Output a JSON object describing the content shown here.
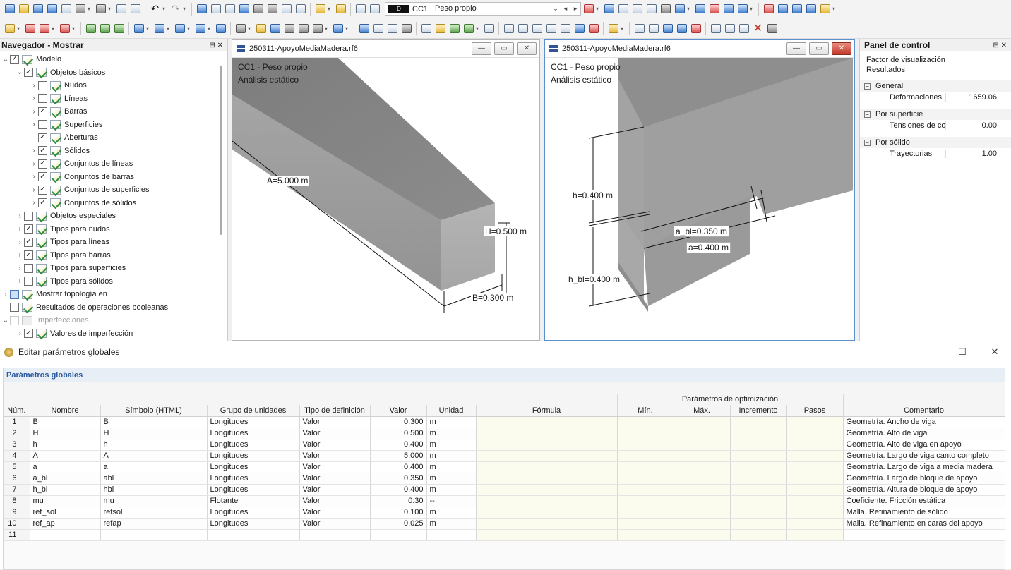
{
  "toolbar": {
    "loadcase_id": "CC1",
    "loadcase_name": "Peso propio",
    "loadcase_tag": "D"
  },
  "navigator": {
    "title": "Navegador - Mostrar",
    "pin": "⊟  ✕",
    "items": [
      {
        "label": "Modelo",
        "level": 0,
        "expander": "⌄",
        "state": "checked"
      },
      {
        "label": "Objetos básicos",
        "level": 1,
        "expander": "⌄",
        "state": "checked"
      },
      {
        "label": "Nudos",
        "level": 2,
        "expander": "›",
        "state": "unchecked"
      },
      {
        "label": "Líneas",
        "level": 2,
        "expander": "›",
        "state": "unchecked"
      },
      {
        "label": "Barras",
        "level": 2,
        "expander": "›",
        "state": "checked"
      },
      {
        "label": "Superficies",
        "level": 2,
        "expander": "›",
        "state": "unchecked"
      },
      {
        "label": "Aberturas",
        "level": 2,
        "expander": "",
        "state": "checked"
      },
      {
        "label": "Sólidos",
        "level": 2,
        "expander": "›",
        "state": "checked"
      },
      {
        "label": "Conjuntos de líneas",
        "level": 2,
        "expander": "›",
        "state": "checked"
      },
      {
        "label": "Conjuntos de barras",
        "level": 2,
        "expander": "›",
        "state": "checked"
      },
      {
        "label": "Conjuntos de superficies",
        "level": 2,
        "expander": "›",
        "state": "checked"
      },
      {
        "label": "Conjuntos de sólidos",
        "level": 2,
        "expander": "›",
        "state": "checked"
      },
      {
        "label": "Objetos especiales",
        "level": 1,
        "expander": "›",
        "state": "unchecked"
      },
      {
        "label": "Tipos para nudos",
        "level": 1,
        "expander": "›",
        "state": "checked"
      },
      {
        "label": "Tipos para líneas",
        "level": 1,
        "expander": "›",
        "state": "checked"
      },
      {
        "label": "Tipos para barras",
        "level": 1,
        "expander": "›",
        "state": "checked"
      },
      {
        "label": "Tipos para superficies",
        "level": 1,
        "expander": "›",
        "state": "unchecked"
      },
      {
        "label": "Tipos para sólidos",
        "level": 1,
        "expander": "›",
        "state": "unchecked"
      },
      {
        "label": "Mostrar topología en",
        "level": 0,
        "expander": "›",
        "state": "partial"
      },
      {
        "label": "Resultados de operaciones booleanas",
        "level": 0,
        "expander": "",
        "state": "unchecked"
      },
      {
        "label": "Imperfecciones",
        "level": 0,
        "expander": "⌄",
        "state": "disabled"
      },
      {
        "label": "Valores de imperfección",
        "level": 1,
        "expander": "›",
        "state": "checked"
      }
    ]
  },
  "viewport1": {
    "file": "250311-ApoyoMediaMadera.rf6",
    "line1": "CC1 - Peso propio",
    "line2": "Análisis estático",
    "dim_A": "A=5.000 m",
    "dim_H": "H=0.500 m",
    "dim_B": "B=0.300 m",
    "btn_min": "—",
    "btn_max": "▭",
    "btn_close": "✕"
  },
  "viewport2": {
    "file": "250311-ApoyoMediaMadera.rf6",
    "line1": "CC1 - Peso propio",
    "line2": "Análisis estático",
    "dim_h": "h=0.400 m",
    "dim_hbl": "h_bl=0.400 m",
    "dim_abl": "a_bl=0.350 m",
    "dim_a": "a=0.400 m",
    "btn_min": "—",
    "btn_max": "▭",
    "btn_close": "✕"
  },
  "control_panel": {
    "title": "Panel de control",
    "pin": "⊟  ✕",
    "sub1": "Factor de visualización",
    "sub2": "Resultados",
    "sections": [
      {
        "name": "General",
        "row_label": "Deformaciones",
        "row_value": "1659.06"
      },
      {
        "name": "Por superficie",
        "row_label": "Tensiones de conta...",
        "row_value": "0.00"
      },
      {
        "name": "Por sólido",
        "row_label": "Trayectorias",
        "row_value": "1.00"
      }
    ]
  },
  "dialog": {
    "title": "Editar parámetros globales",
    "group": "Parámetros globales",
    "opt_header": "Parámetros de optimización",
    "btn_min": "—",
    "btn_max": "☐",
    "btn_close": "✕",
    "columns": [
      "Núm.",
      "Nombre",
      "Símbolo (HTML)",
      "Grupo de unidades",
      "Tipo de definición",
      "Valor",
      "Unidad",
      "Fórmula",
      "Mín.",
      "Máx.",
      "Incremento",
      "Pasos",
      "Comentario"
    ],
    "rows": [
      [
        "1",
        "B",
        "B",
        "Longitudes",
        "Valor",
        "0.300",
        "m",
        "",
        "",
        "",
        "",
        "",
        "Geometría. Ancho de viga"
      ],
      [
        "2",
        "H",
        "H",
        "Longitudes",
        "Valor",
        "0.500",
        "m",
        "",
        "",
        "",
        "",
        "",
        "Geometría. Alto de viga"
      ],
      [
        "3",
        "h",
        "h",
        "Longitudes",
        "Valor",
        "0.400",
        "m",
        "",
        "",
        "",
        "",
        "",
        "Geometría. Alto de viga en apoyo"
      ],
      [
        "4",
        "A",
        "A",
        "Longitudes",
        "Valor",
        "5.000",
        "m",
        "",
        "",
        "",
        "",
        "",
        "Geometría. Largo de viga canto completo"
      ],
      [
        "5",
        "a",
        "a",
        "Longitudes",
        "Valor",
        "0.400",
        "m",
        "",
        "",
        "",
        "",
        "",
        "Geometría. Largo de viga a media madera"
      ],
      [
        "6",
        "a_bl",
        "abl",
        "Longitudes",
        "Valor",
        "0.350",
        "m",
        "",
        "",
        "",
        "",
        "",
        "Geometría. Largo de bloque de apoyo"
      ],
      [
        "7",
        "h_bl",
        "hbl",
        "Longitudes",
        "Valor",
        "0.400",
        "m",
        "",
        "",
        "",
        "",
        "",
        "Geometría. Altura de bloque de apoyo"
      ],
      [
        "8",
        "mu",
        "mu",
        "Flotante",
        "Valor",
        "0.30",
        "--",
        "",
        "",
        "",
        "",
        "",
        "Coeficiente. Fricción estática"
      ],
      [
        "9",
        "ref_sol",
        "refsol",
        "Longitudes",
        "Valor",
        "0.100",
        "m",
        "",
        "",
        "",
        "",
        "",
        "Malla. Refinamiento de sólido"
      ],
      [
        "10",
        "ref_ap",
        "refap",
        "Longitudes",
        "Valor",
        "0.025",
        "m",
        "",
        "",
        "",
        "",
        "",
        "Malla. Refinamiento en caras del apoyo"
      ],
      [
        "11",
        "",
        "",
        "",
        "",
        "",
        "",
        "",
        "",
        "",
        "",
        "",
        ""
      ]
    ]
  }
}
